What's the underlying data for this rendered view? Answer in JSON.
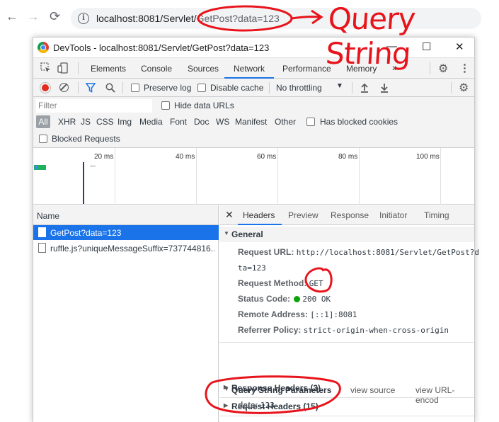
{
  "browser": {
    "back": "←",
    "forward": "→",
    "reload": "⟳",
    "url_host": "localhost:8081/Servlet/",
    "url_path": "GetPost?data=123"
  },
  "annotation": {
    "text": "Query String",
    "color": "#e8141c"
  },
  "devtools": {
    "title": "DevTools - localhost:8081/Servlet/GetPost?data=123",
    "tabs": [
      "Elements",
      "Console",
      "Sources",
      "Network",
      "Performance",
      "Memory"
    ],
    "active_tab": "Network",
    "more_tabs": "»",
    "toolbar": {
      "preserve_log": "Preserve log",
      "disable_cache": "Disable cache",
      "throttling": "No throttling"
    },
    "filter": {
      "placeholder": "Filter",
      "hide_data_urls": "Hide data URLs",
      "types": [
        "All",
        "XHR",
        "JS",
        "CSS",
        "Img",
        "Media",
        "Font",
        "Doc",
        "WS",
        "Manifest",
        "Other"
      ],
      "has_blocked_cookies": "Has blocked cookies",
      "blocked_requests": "Blocked Requests"
    },
    "overview_ticks": [
      "20 ms",
      "40 ms",
      "60 ms",
      "80 ms",
      "100 ms"
    ],
    "name_header": "Name",
    "requests": [
      "GetPost?data=123",
      "ruffle.js?uniqueMessageSuffix=737744816..."
    ],
    "detail_tabs": [
      "Headers",
      "Preview",
      "Response",
      "Initiator",
      "Timing"
    ],
    "general": {
      "title": "General",
      "request_url_label": "Request URL:",
      "request_url_value": "http://localhost:8081/Servlet/GetPost?d",
      "request_url_cont": "ta=123",
      "method_label": "Request Method:",
      "method_value": "GET",
      "status_label": "Status Code:",
      "status_value": "200 OK",
      "remote_label": "Remote Address:",
      "remote_value": "[::1]:8081",
      "referrer_label": "Referrer Policy:",
      "referrer_value": "strict-origin-when-cross-origin"
    },
    "response_headers": "Response Headers (3)",
    "request_headers": "Request Headers (15)",
    "qsp": {
      "title": "Query String Parameters",
      "view_source": "view source",
      "view_url": "view URL-encod",
      "key": "data:",
      "value": "123"
    }
  }
}
